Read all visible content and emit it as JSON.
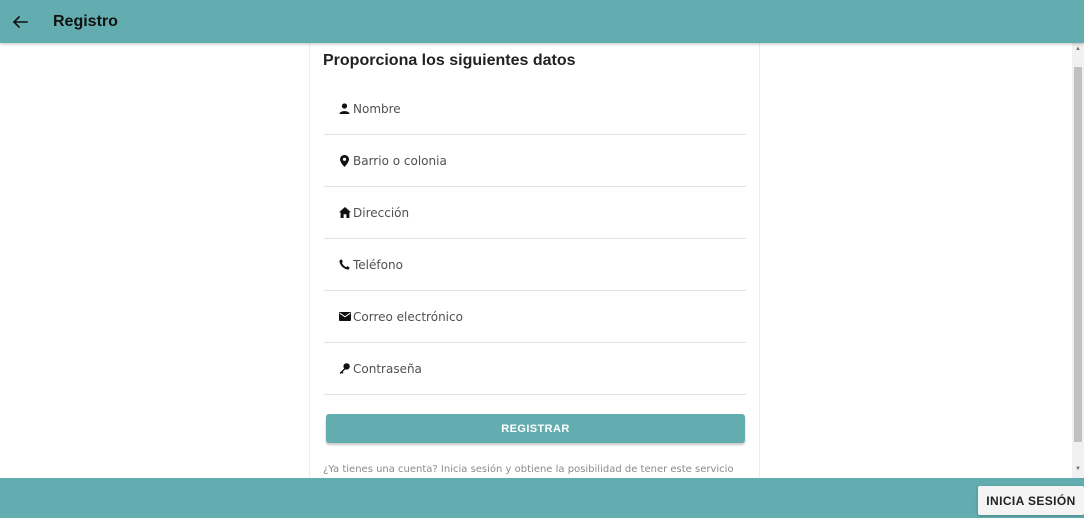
{
  "appbar": {
    "title": "Registro",
    "back_icon": "arrow-left-icon"
  },
  "form": {
    "heading": "Proporciona los siguientes datos",
    "fields": [
      {
        "icon": "person-icon",
        "placeholder": "Nombre",
        "value": ""
      },
      {
        "icon": "location-pin-icon",
        "placeholder": "Barrio o colonia",
        "value": ""
      },
      {
        "icon": "home-icon",
        "placeholder": "Dirección",
        "value": ""
      },
      {
        "icon": "phone-icon",
        "placeholder": "Teléfono",
        "value": ""
      },
      {
        "icon": "mail-icon",
        "placeholder": "Correo electrónico",
        "value": ""
      },
      {
        "icon": "key-icon",
        "placeholder": "Contraseña",
        "value": ""
      }
    ],
    "submit_label": "REGISTRAR",
    "footnote": "¿Ya tienes una cuenta? Inicia sesión y obtiene la posibilidad de tener este servicio"
  },
  "footer": {
    "login_label": "INICIA SESIÓN"
  },
  "colors": {
    "accent": "#63adb0",
    "text": "#222222"
  }
}
